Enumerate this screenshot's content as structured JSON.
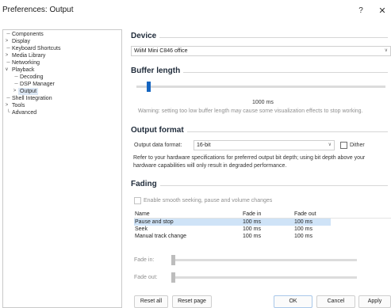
{
  "window": {
    "title": "Preferences: Output",
    "help_label": "?",
    "close_label": "✕"
  },
  "tree": {
    "items": [
      {
        "label": "Components",
        "glyph": ""
      },
      {
        "label": "Display",
        "glyph": ">"
      },
      {
        "label": "Keyboard Shortcuts",
        "glyph": ""
      },
      {
        "label": "Media Library",
        "glyph": ">"
      },
      {
        "label": "Networking",
        "glyph": ""
      },
      {
        "label": "Playback",
        "glyph": "∨"
      },
      {
        "label": "Decoding",
        "glyph": ""
      },
      {
        "label": "DSP Manager",
        "glyph": ""
      },
      {
        "label": "Output",
        "glyph": ">"
      },
      {
        "label": "Shell Integration",
        "glyph": ""
      },
      {
        "label": "Tools",
        "glyph": ">"
      },
      {
        "label": "Advanced",
        "glyph": ""
      }
    ],
    "selected": "Output"
  },
  "device": {
    "heading": "Device",
    "value": "WiiM Mini C846 office"
  },
  "buffer": {
    "heading": "Buffer length",
    "value_label": "1000 ms",
    "warning": "Warning: setting too low buffer length may cause some visualization effects to stop working."
  },
  "output_format": {
    "heading": "Output format",
    "label": "Output data format:",
    "value": "16-bit",
    "dither_label": "Dither",
    "dither_checked": false,
    "note_line1": "Refer to your hardware specifications for preferred output bit depth; using bit depth above your",
    "note_line2": "hardware capabilities will only result in degraded performance."
  },
  "fading": {
    "heading": "Fading",
    "enable_label": "Enable smooth seeking, pause and volume changes",
    "enable_checked": false,
    "columns": [
      "Name",
      "Fade in",
      "Fade out"
    ],
    "rows": [
      [
        "Pause and stop",
        "100 ms",
        "100 ms"
      ],
      [
        "Seek",
        "100 ms",
        "100 ms"
      ],
      [
        "Manual track change",
        "100 ms",
        "100 ms"
      ]
    ],
    "selected_row": "Pause and stop",
    "fade_in_label": "Fade in:",
    "fade_out_label": "Fade out:"
  },
  "buttons": {
    "reset_all": "Reset all",
    "reset_page": "Reset page",
    "ok": "OK",
    "cancel": "Cancel",
    "apply": "Apply"
  },
  "colors": {
    "accent": "#1565c0",
    "selection": "#cfe3f7"
  }
}
